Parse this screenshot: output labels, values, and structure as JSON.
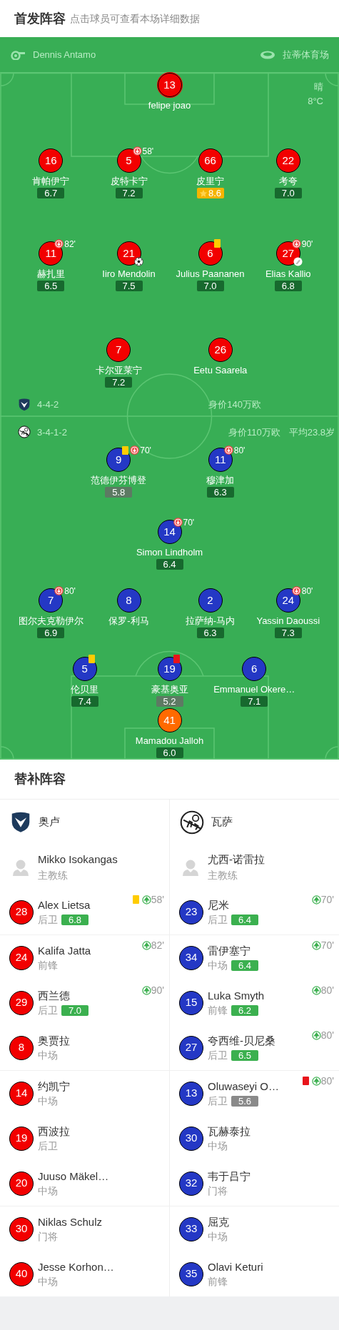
{
  "header": {
    "title": "首发阵容",
    "hint": "点击球员可查看本场详细数据"
  },
  "match_info": {
    "referee": "Dennis Antamo",
    "stadium": "拉蒂体育场",
    "weather": "晴",
    "temperature": "8°C"
  },
  "home": {
    "formation": "4-4-2",
    "value": "身价140万欧",
    "lines": [
      [
        {
          "number": "13",
          "name": "felipe joao",
          "goalkeeper": true
        }
      ],
      [
        {
          "number": "16",
          "name": "肯帕伊宁",
          "goalkeeper": false,
          "rating": {
            "value": "6.7",
            "kind": "normal"
          }
        },
        {
          "number": "5",
          "name": "皮特卡宁",
          "goalkeeper": false,
          "rating": {
            "value": "7.2",
            "kind": "normal"
          },
          "events": [
            {
              "kind": "sub_off",
              "minute": "58'"
            }
          ]
        },
        {
          "number": "66",
          "name": "皮里宁",
          "goalkeeper": false,
          "rating": {
            "value": "8.6",
            "kind": "best"
          }
        },
        {
          "number": "22",
          "name": "考夸",
          "goalkeeper": false,
          "rating": {
            "value": "7.0",
            "kind": "normal"
          }
        }
      ],
      [
        {
          "number": "11",
          "name": "赫扎里",
          "goalkeeper": false,
          "rating": {
            "value": "6.5",
            "kind": "normal"
          },
          "events": [
            {
              "kind": "sub_off",
              "minute": "82'"
            }
          ]
        },
        {
          "number": "21",
          "name": "Iiro Mendolin",
          "goalkeeper": false,
          "rating": {
            "value": "7.5",
            "kind": "normal"
          },
          "events": [
            {
              "kind": "goal"
            }
          ]
        },
        {
          "number": "6",
          "name": "Julius Paananen",
          "goalkeeper": false,
          "rating": {
            "value": "7.0",
            "kind": "normal"
          },
          "events": [
            {
              "kind": "yellow"
            }
          ]
        },
        {
          "number": "27",
          "name": "Elias Kallio",
          "goalkeeper": false,
          "rating": {
            "value": "6.8",
            "kind": "normal"
          },
          "events": [
            {
              "kind": "sub_off",
              "minute": "90'"
            },
            {
              "kind": "assist"
            }
          ]
        }
      ],
      [
        {
          "number": "7",
          "name": "卡尔亚莱宁",
          "goalkeeper": false,
          "rating": {
            "value": "7.2",
            "kind": "normal"
          }
        },
        {
          "number": "26",
          "name": "Eetu Saarela",
          "goalkeeper": false
        }
      ]
    ]
  },
  "away": {
    "formation": "3-4-1-2",
    "value": "身价110万欧",
    "average_age": "平均23.8岁",
    "lines": [
      [
        {
          "number": "9",
          "name": "范德伊芬博登",
          "goalkeeper": false,
          "rating": {
            "value": "5.8",
            "kind": "low"
          },
          "events": [
            {
              "kind": "yellow"
            },
            {
              "kind": "sub_off",
              "minute": "70'"
            }
          ]
        },
        {
          "number": "11",
          "name": "穆津加",
          "goalkeeper": false,
          "rating": {
            "value": "6.3",
            "kind": "normal"
          },
          "events": [
            {
              "kind": "sub_off",
              "minute": "80'"
            }
          ]
        }
      ],
      [
        {
          "number": "14",
          "name": "Simon Lindholm",
          "goalkeeper": false,
          "rating": {
            "value": "6.4",
            "kind": "normal"
          },
          "events": [
            {
              "kind": "sub_off",
              "minute": "70'"
            }
          ]
        }
      ],
      [
        {
          "number": "7",
          "name": "图尔夫克勒伊尔",
          "goalkeeper": false,
          "rating": {
            "value": "6.9",
            "kind": "normal"
          },
          "events": [
            {
              "kind": "sub_off",
              "minute": "80'"
            }
          ]
        },
        {
          "number": "8",
          "name": "保罗-利马",
          "goalkeeper": false
        },
        {
          "number": "2",
          "name": "拉萨纳-马内",
          "goalkeeper": false,
          "rating": {
            "value": "6.3",
            "kind": "normal"
          }
        },
        {
          "number": "24",
          "name": "Yassin Daoussi",
          "goalkeeper": false,
          "rating": {
            "value": "7.3",
            "kind": "normal"
          },
          "events": [
            {
              "kind": "sub_off",
              "minute": "80'"
            }
          ]
        }
      ],
      [
        {
          "number": "5",
          "name": "伦贝里",
          "goalkeeper": false,
          "rating": {
            "value": "7.4",
            "kind": "normal"
          },
          "events": [
            {
              "kind": "yellow"
            }
          ]
        },
        {
          "number": "19",
          "name": "豪基奥亚",
          "goalkeeper": false,
          "rating": {
            "value": "5.2",
            "kind": "low"
          },
          "events": [
            {
              "kind": "red"
            }
          ]
        },
        {
          "number": "6",
          "name": "Emmanuel Okere…",
          "goalkeeper": false,
          "rating": {
            "value": "7.1",
            "kind": "normal"
          }
        }
      ],
      [
        {
          "number": "41",
          "name": "Mamadou Jalloh",
          "goalkeeper": true,
          "rating": {
            "value": "6.0",
            "kind": "normal"
          }
        }
      ]
    ]
  },
  "substitutes": {
    "title": "替补阵容",
    "teams": [
      {
        "name": "奥卢",
        "kind": "home",
        "coach": {
          "name": "Mikko Isokangas",
          "role": "主教练"
        },
        "groups": [
          [
            {
              "number": "28",
              "name": "Alex Lietsa",
              "position": "后卫",
              "rating": {
                "value": "6.8",
                "kind": "normal"
              },
              "events": [
                {
                  "kind": "yellow"
                },
                {
                  "kind": "sub_on",
                  "minute": "58'"
                }
              ]
            }
          ],
          [
            {
              "number": "24",
              "name": "Kalifa Jatta",
              "position": "前锋",
              "events": [
                {
                  "kind": "sub_on",
                  "minute": "82'"
                }
              ]
            },
            {
              "number": "29",
              "name": "西兰德",
              "position": "后卫",
              "rating": {
                "value": "7.0",
                "kind": "normal"
              },
              "events": [
                {
                  "kind": "sub_on",
                  "minute": "90'"
                }
              ]
            },
            {
              "number": "8",
              "name": "奥贾拉",
              "position": "中场"
            }
          ],
          [
            {
              "number": "14",
              "name": "约凯宁",
              "position": "中场"
            },
            {
              "number": "19",
              "name": "西波拉",
              "position": "后卫"
            },
            {
              "number": "20",
              "name": "Juuso Mäkel…",
              "position": "中场"
            }
          ],
          [
            {
              "number": "30",
              "name": "Niklas Schulz",
              "position": "门将"
            },
            {
              "number": "40",
              "name": "Jesse Korhon…",
              "position": "中场"
            }
          ]
        ]
      },
      {
        "name": "瓦萨",
        "kind": "away",
        "coach": {
          "name": "尤西-诺雷拉",
          "role": "主教练"
        },
        "groups": [
          [
            {
              "number": "23",
              "name": "尼米",
              "position": "后卫",
              "rating": {
                "value": "6.4",
                "kind": "normal"
              },
              "events": [
                {
                  "kind": "sub_on",
                  "minute": "70'"
                }
              ]
            }
          ],
          [
            {
              "number": "34",
              "name": "雷伊塞宁",
              "position": "中场",
              "rating": {
                "value": "6.4",
                "kind": "normal"
              },
              "events": [
                {
                  "kind": "sub_on",
                  "minute": "70'"
                }
              ]
            },
            {
              "number": "15",
              "name": "Luka Smyth",
              "position": "前锋",
              "rating": {
                "value": "6.2",
                "kind": "normal"
              },
              "events": [
                {
                  "kind": "sub_on",
                  "minute": "80'"
                }
              ]
            },
            {
              "number": "27",
              "name": "夸西维-贝尼桑",
              "position": "后卫",
              "rating": {
                "value": "6.5",
                "kind": "normal"
              },
              "events": [
                {
                  "kind": "sub_on",
                  "minute": "80'"
                }
              ]
            }
          ],
          [
            {
              "number": "13",
              "name": "Oluwaseyi O…",
              "position": "后卫",
              "rating": {
                "value": "5.6",
                "kind": "low"
              },
              "events": [
                {
                  "kind": "red"
                },
                {
                  "kind": "sub_on",
                  "minute": "80'"
                }
              ]
            },
            {
              "number": "30",
              "name": "瓦赫泰拉",
              "position": "中场"
            },
            {
              "number": "32",
              "name": "韦于吕宁",
              "position": "门将"
            }
          ],
          [
            {
              "number": "33",
              "name": "屈克",
              "position": "中场"
            },
            {
              "number": "35",
              "name": "Olavi Keturi",
              "position": "前锋"
            }
          ]
        ]
      }
    ]
  }
}
